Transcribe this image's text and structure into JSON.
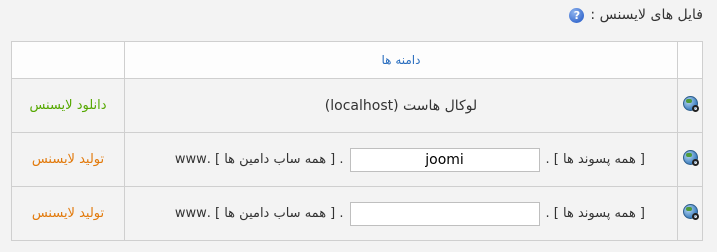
{
  "header": {
    "title": "فایل های لایسنس :",
    "help_icon": "help-icon"
  },
  "table": {
    "column_header": "دامنه ها",
    "rows": [
      {
        "domain_text": "لوکال هاست (localhost)",
        "action": "دانلود لایسنس",
        "action_color": "#55a800"
      },
      {
        "prefix": "[ همه پسوند ها ] .",
        "input_value": "joomi",
        "suffix": ". [ همه ساب دامین ها ] .www",
        "action": "تولید لایسنس",
        "action_color": "#e27a0c"
      },
      {
        "prefix": "[ همه پسوند ها ] .",
        "input_value": "",
        "suffix": ". [ همه ساب دامین ها ] .www",
        "action": "تولید لایسنس",
        "action_color": "#e27a0c"
      }
    ]
  }
}
